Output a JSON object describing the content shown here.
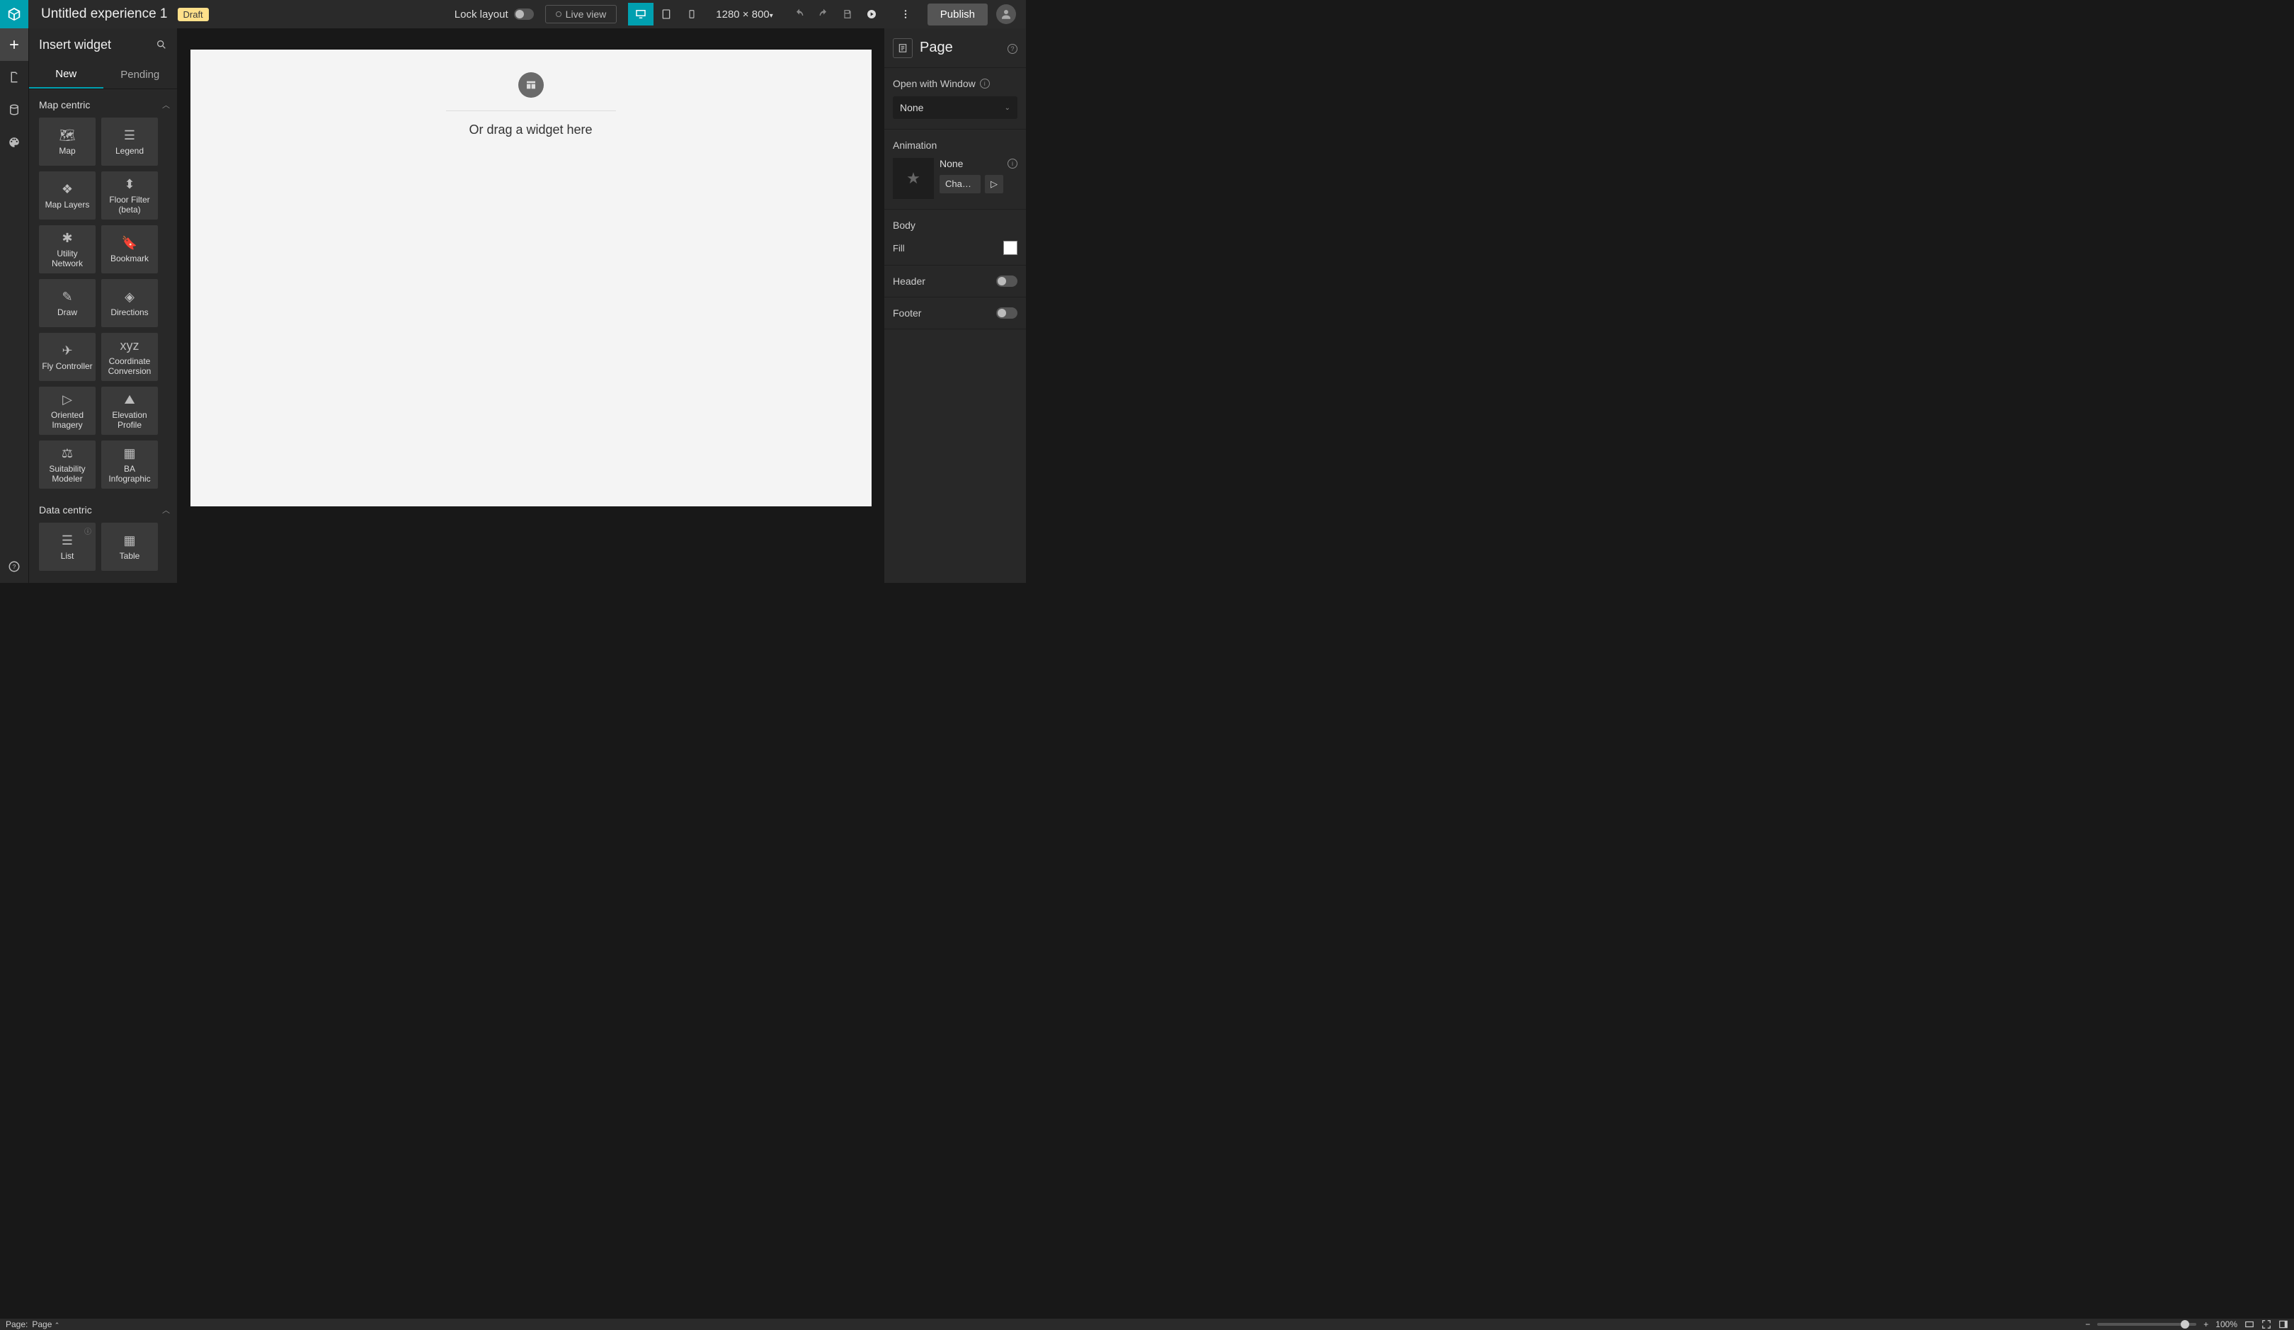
{
  "header": {
    "title": "Untitled experience 1",
    "draft_label": "Draft",
    "lock_layout_label": "Lock layout",
    "live_view_label": "Live view",
    "canvas_size": "1280 × 800",
    "publish_label": "Publish"
  },
  "insert_panel": {
    "title": "Insert widget",
    "tabs": {
      "new": "New",
      "pending": "Pending"
    },
    "sections": [
      {
        "name": "Map centric",
        "widgets": [
          "Map",
          "Legend",
          "Map Layers",
          "Floor Filter (beta)",
          "Utility Network",
          "Bookmark",
          "Draw",
          "Directions",
          "Fly Controller",
          "Coordinate Conversion",
          "Oriented Imagery",
          "Elevation Profile",
          "Suitability Modeler",
          "BA Infographic"
        ]
      },
      {
        "name": "Data centric",
        "widgets": [
          "List",
          "Table"
        ]
      }
    ]
  },
  "canvas": {
    "drop_text": "Or drag a widget here"
  },
  "right_panel": {
    "title": "Page",
    "open_window_label": "Open with Window",
    "open_window_value": "None",
    "animation_label": "Animation",
    "animation_name": "None",
    "change_label": "Cha…",
    "body_label": "Body",
    "fill_label": "Fill",
    "fill_color": "#ffffff",
    "header_label": "Header",
    "footer_label": "Footer"
  },
  "footer": {
    "page_label": "Page:",
    "page_value": "Page",
    "zoom_value": "100%"
  }
}
